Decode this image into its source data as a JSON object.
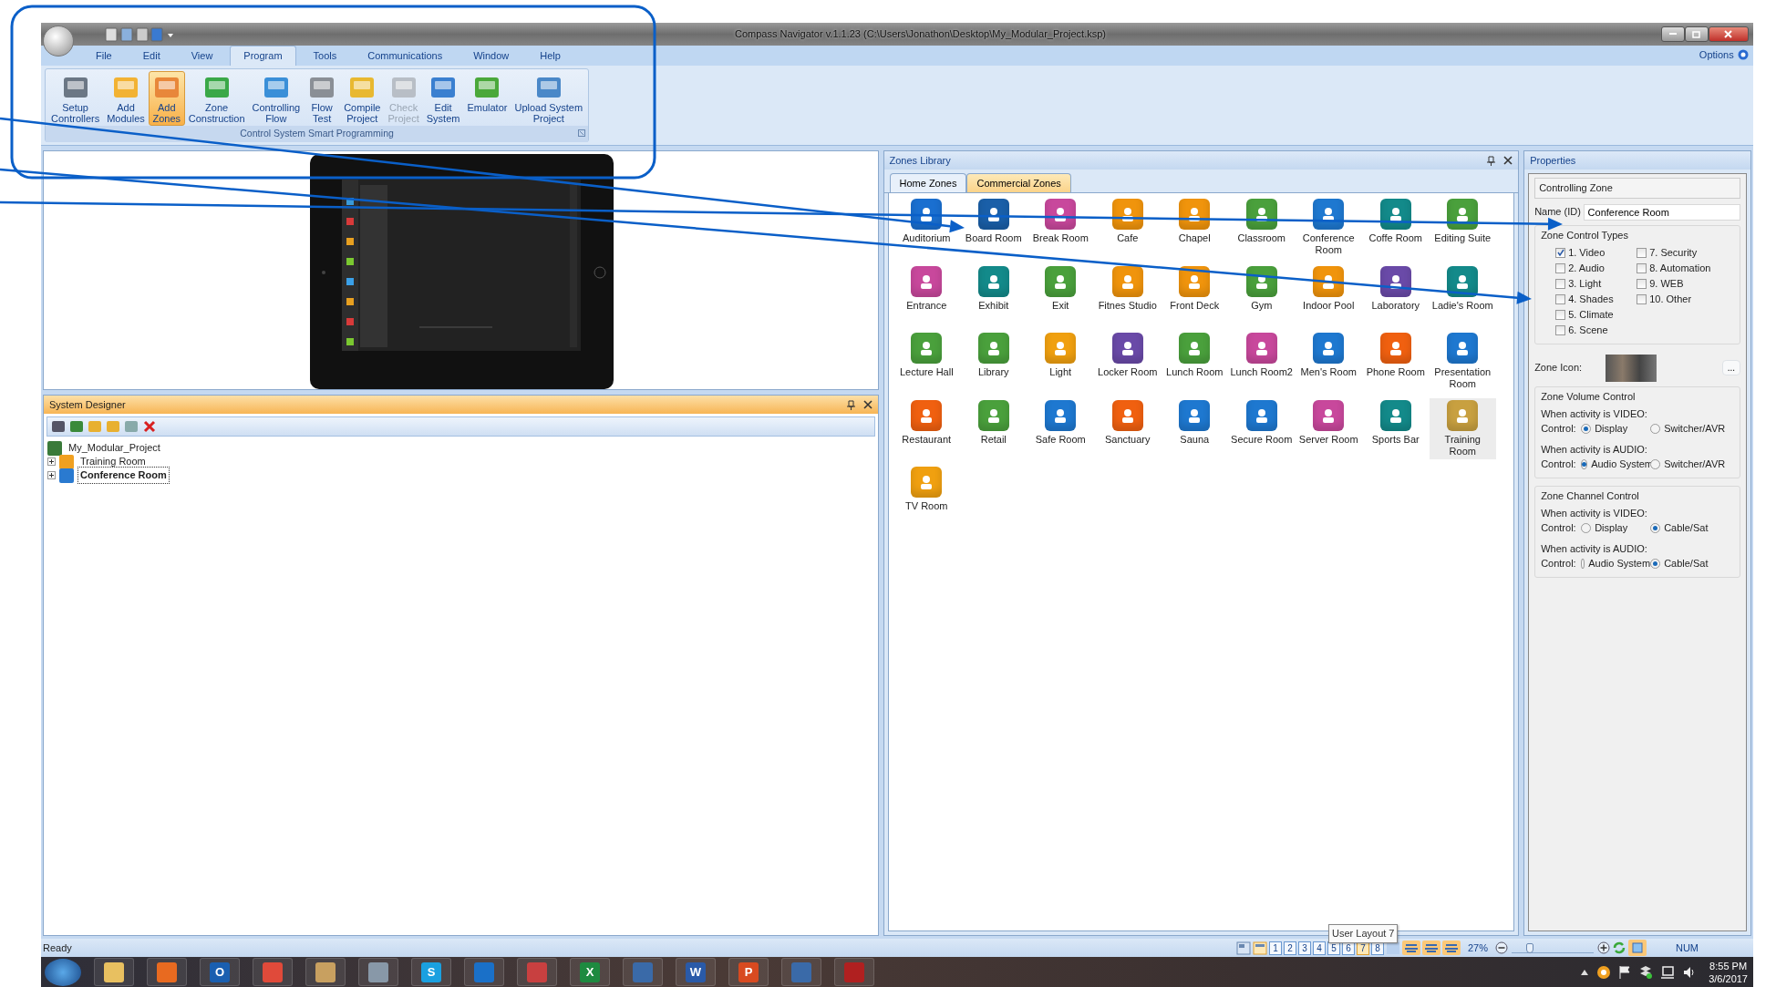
{
  "window": {
    "title": "Compass Navigator  v.1.1.23 (C:\\Users\\Jonathon\\Desktop\\My_Modular_Project.ksp)"
  },
  "menu": [
    {
      "label": "File",
      "selected": false
    },
    {
      "label": "Edit",
      "selected": false
    },
    {
      "label": "View",
      "selected": false
    },
    {
      "label": "Program",
      "selected": true
    },
    {
      "label": "Tools",
      "selected": false
    },
    {
      "label": "Communications",
      "selected": false
    },
    {
      "label": "Window",
      "selected": false
    },
    {
      "label": "Help",
      "selected": false
    }
  ],
  "options": "Options",
  "ribbon": {
    "group_label": "Control System Smart Programming",
    "buttons": [
      {
        "lines": [
          "Setup",
          "Controllers"
        ],
        "color": "#6b7785",
        "selected": false,
        "disabled": false
      },
      {
        "lines": [
          "Add",
          "Modules"
        ],
        "color": "#f2b233",
        "selected": false,
        "disabled": false
      },
      {
        "lines": [
          "Add",
          "Zones"
        ],
        "color": "#e8873a",
        "selected": true,
        "disabled": false
      },
      {
        "lines": [
          "Zone",
          "Construction"
        ],
        "color": "#3aa848",
        "selected": false,
        "disabled": false
      },
      {
        "lines": [
          "Controlling",
          "Flow"
        ],
        "color": "#3a8fd8",
        "selected": false,
        "disabled": false
      },
      {
        "lines": [
          "Flow",
          "Test"
        ],
        "color": "#8a8f96",
        "selected": false,
        "disabled": false
      },
      {
        "lines": [
          "Compile",
          "Project"
        ],
        "color": "#e8b830",
        "selected": false,
        "disabled": false
      },
      {
        "lines": [
          "Check",
          "Project"
        ],
        "color": "#b8bec6",
        "selected": false,
        "disabled": true
      },
      {
        "lines": [
          "Edit",
          "System"
        ],
        "color": "#3a7fd0",
        "selected": false,
        "disabled": false
      },
      {
        "lines": [
          "Emulator"
        ],
        "color": "#4aa83a",
        "selected": false,
        "disabled": false
      },
      {
        "lines": [
          "Upload System",
          "Project"
        ],
        "color": "#4a88c8",
        "selected": false,
        "disabled": false
      }
    ]
  },
  "system_designer": {
    "title": "System Designer",
    "tree": [
      {
        "label": "My_Modular_Project",
        "color": "#3a7a3a",
        "selected": false,
        "children": [
          {
            "label": "Training Room",
            "color": "#f0a020",
            "selected": false,
            "expanded": false
          },
          {
            "label": "Conference Room",
            "color": "#2a7ad0",
            "selected": true,
            "expanded": false
          }
        ]
      }
    ]
  },
  "zones_library": {
    "title": "Zones Library",
    "tabs": [
      {
        "label": "Home Zones",
        "selected": false
      },
      {
        "label": "Commercial Zones",
        "selected": true
      }
    ],
    "zones": [
      {
        "label": "Auditorium",
        "color": "#1a6fd0",
        "selected": false
      },
      {
        "label": "Board Room",
        "color": "#1a5fa8",
        "selected": false
      },
      {
        "label": "Break Room",
        "color": "#c8489c",
        "selected": false
      },
      {
        "label": "Cafe",
        "color": "#f0940c",
        "selected": false
      },
      {
        "label": "Chapel",
        "color": "#f0940c",
        "selected": false
      },
      {
        "label": "Classroom",
        "color": "#4aa03c",
        "selected": false
      },
      {
        "label": "Conference Room",
        "color": "#1e78d0",
        "selected": false
      },
      {
        "label": "Coffe Room",
        "color": "#138a8a",
        "selected": false
      },
      {
        "label": "Editing Suite",
        "color": "#4aa03c",
        "selected": false
      },
      {
        "label": "Entrance",
        "color": "#c8489c",
        "selected": false
      },
      {
        "label": "Exhibit",
        "color": "#138a8a",
        "selected": false
      },
      {
        "label": "Exit",
        "color": "#4aa03c",
        "selected": false
      },
      {
        "label": "Fitnes Studio",
        "color": "#f0940c",
        "selected": false
      },
      {
        "label": "Front Deck",
        "color": "#f0940c",
        "selected": false
      },
      {
        "label": "Gym",
        "color": "#4aa03c",
        "selected": false
      },
      {
        "label": "Indoor Pool",
        "color": "#f0940c",
        "selected": false
      },
      {
        "label": "Laboratory",
        "color": "#6a4aa8",
        "selected": false
      },
      {
        "label": "Ladie's Room",
        "color": "#138a8a",
        "selected": false
      },
      {
        "label": "Lecture Hall",
        "color": "#4aa03c",
        "selected": false
      },
      {
        "label": "Library",
        "color": "#4aa03c",
        "selected": false
      },
      {
        "label": "Light",
        "color": "#f0a010",
        "selected": false
      },
      {
        "label": "Locker Room",
        "color": "#6a4aa8",
        "selected": false
      },
      {
        "label": "Lunch Room",
        "color": "#4aa03c",
        "selected": false
      },
      {
        "label": "Lunch Room2",
        "color": "#c8489c",
        "selected": false
      },
      {
        "label": "Men's Room",
        "color": "#1e78d0",
        "selected": false
      },
      {
        "label": "Phone Room",
        "color": "#f06010",
        "selected": false
      },
      {
        "label": "Presentation Room",
        "color": "#1e78d0",
        "selected": false
      },
      {
        "label": "Restaurant",
        "color": "#f06010",
        "selected": false
      },
      {
        "label": "Retail",
        "color": "#4aa03c",
        "selected": false
      },
      {
        "label": "Safe Room",
        "color": "#1e78d0",
        "selected": false
      },
      {
        "label": "Sanctuary",
        "color": "#f06010",
        "selected": false
      },
      {
        "label": "Sauna",
        "color": "#1e78d0",
        "selected": false
      },
      {
        "label": "Secure Room",
        "color": "#1e78d0",
        "selected": false
      },
      {
        "label": "Server Room",
        "color": "#c8489c",
        "selected": false
      },
      {
        "label": "Sports Bar",
        "color": "#138a8a",
        "selected": false
      },
      {
        "label": "Training Room",
        "color": "#c8a040",
        "selected": true
      },
      {
        "label": "TV Room",
        "color": "#f0a010",
        "selected": false
      }
    ]
  },
  "properties": {
    "title": "Properties",
    "header": "Controlling Zone",
    "name_label": "Name (ID)",
    "name_value": "Conference Room",
    "control_types": {
      "title": "Zone Control Types",
      "items": [
        {
          "label": "1. Video",
          "checked": true
        },
        {
          "label": "2. Audio",
          "checked": false
        },
        {
          "label": "3. Light",
          "checked": false
        },
        {
          "label": "4. Shades",
          "checked": false
        },
        {
          "label": "5. Climate",
          "checked": false
        },
        {
          "label": "6. Scene",
          "checked": false
        },
        {
          "label": "7. Security",
          "checked": false
        },
        {
          "label": "8. Automation",
          "checked": false
        },
        {
          "label": "9. WEB",
          "checked": false
        },
        {
          "label": "10. Other",
          "checked": false
        }
      ]
    },
    "zone_icon_label": "Zone Icon:",
    "browse_button": "...",
    "groups": [
      {
        "title": "Zone Volume Control",
        "sections": [
          {
            "prompt": "When activity is VIDEO:",
            "label": "Control:",
            "options": [
              {
                "label": "Display",
                "selected": true
              },
              {
                "label": "Switcher/AVR",
                "selected": false
              }
            ]
          },
          {
            "prompt": "When activity is AUDIO:",
            "label": "Control:",
            "options": [
              {
                "label": "Audio System",
                "selected": true
              },
              {
                "label": "Switcher/AVR",
                "selected": false
              }
            ]
          }
        ]
      },
      {
        "title": "Zone Channel Control",
        "sections": [
          {
            "prompt": "When activity is VIDEO:",
            "label": "Control:",
            "options": [
              {
                "label": "Display",
                "selected": false
              },
              {
                "label": "Cable/Sat",
                "selected": true
              }
            ]
          },
          {
            "prompt": "When activity is AUDIO:",
            "label": "Control:",
            "options": [
              {
                "label": "Audio System",
                "selected": false
              },
              {
                "label": "Cable/Sat",
                "selected": true
              }
            ]
          }
        ]
      }
    ]
  },
  "status_bar": {
    "text": "Ready",
    "layouts": [
      {
        "label": "1",
        "selected": false
      },
      {
        "label": "2",
        "selected": false
      },
      {
        "label": "3",
        "selected": false
      },
      {
        "label": "4",
        "selected": false
      },
      {
        "label": "5",
        "selected": false
      },
      {
        "label": "6",
        "selected": false
      },
      {
        "label": "7",
        "selected": true
      },
      {
        "label": "8",
        "selected": false
      }
    ],
    "tooltip": "User Layout 7",
    "zoom": "27%",
    "zoom_slider": {
      "level": 0.22
    },
    "num": "NUM"
  },
  "taskbar": {
    "apps": [
      {
        "color": "#e8c060"
      },
      {
        "color": "#e86a20"
      },
      {
        "color": "#1a5fb0",
        "glyph": "O"
      },
      {
        "color": "#e04a3a"
      },
      {
        "color": "#c8a060"
      },
      {
        "color": "#8898a8"
      },
      {
        "color": "#1aa0e0",
        "glyph": "S"
      },
      {
        "color": "#1a70c8"
      },
      {
        "color": "#c84040"
      },
      {
        "color": "#1e8a40",
        "glyph": "X"
      },
      {
        "color": "#3a6aa8"
      },
      {
        "color": "#2a5aa8",
        "glyph": "W"
      },
      {
        "color": "#d84a20",
        "glyph": "P"
      },
      {
        "color": "#3a6aa8"
      },
      {
        "color": "#b02020"
      }
    ],
    "time": "8:55 PM",
    "date": "3/6/2017"
  }
}
